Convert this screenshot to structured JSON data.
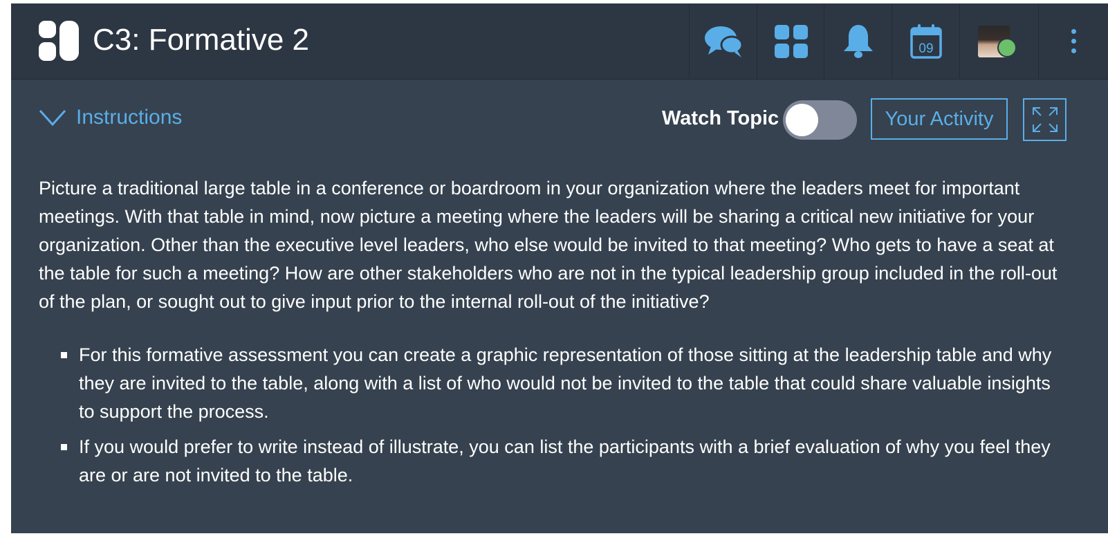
{
  "header": {
    "title": "C3: Formative 2",
    "icons": {
      "logo": "app-logo",
      "messages": "chat-bubbles-icon",
      "apps": "grid-icon",
      "notifications": "bell-icon",
      "calendar": "calendar-icon",
      "profile": "avatar",
      "more": "vertical-dots-icon"
    },
    "calendar_day": "09",
    "presence_status_color": "#6cc06a"
  },
  "toolbar": {
    "instructions_label": "Instructions",
    "watch_topic_label": "Watch Topic",
    "watch_topic_on": false,
    "your_activity_label": "Your Activity"
  },
  "content": {
    "paragraph": "Picture a traditional large table in a conference or boardroom in your organization where the leaders meet for important meetings. With that table in mind, now picture a meeting where the leaders will be sharing a critical new initiative for your organization. Other than the executive level leaders, who else would be invited to that meeting? Who gets to have a seat at the table for such a meeting? How are other stakeholders who are not in the typical leadership group included in the roll-out of the plan, or sought out to give input prior to the internal roll-out of the initiative?",
    "bullets": [
      "For this formative assessment you can create a graphic representation of those sitting at the leadership table and why they are invited to the table, along with a list of who would not be invited to the table that could share valuable insights to support the process.",
      "If you would prefer to write instead of illustrate, you can list the participants with a brief evaluation of why you feel they are or are not invited to the table."
    ]
  },
  "colors": {
    "accent": "#5aaee8",
    "header_bg": "#2d3743",
    "body_bg": "#36424f",
    "toggle_off": "#7f8798"
  }
}
